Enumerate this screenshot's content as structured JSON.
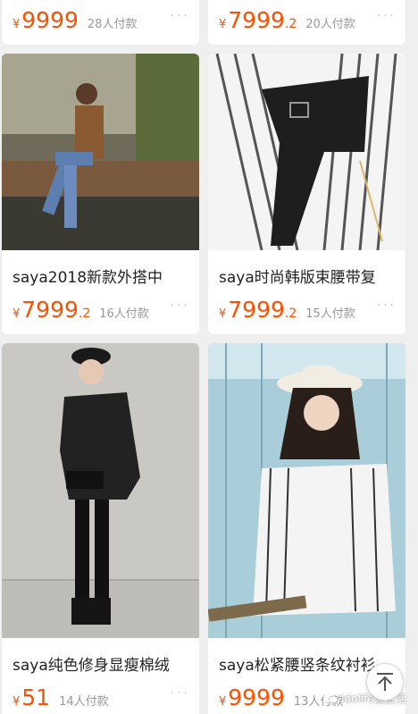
{
  "products": [
    {
      "title": "",
      "price_main": "9999",
      "price_dec": "",
      "buyers": "28人付款"
    },
    {
      "title": "",
      "price_main": "7999",
      "price_dec": ".2",
      "buyers": "20人付款"
    },
    {
      "title": "saya2018新款外搭中",
      "price_main": "7999",
      "price_dec": ".2",
      "buyers": "16人付款"
    },
    {
      "title": "saya时尚韩版束腰带复",
      "price_main": "7999",
      "price_dec": ".2",
      "buyers": "15人付款"
    },
    {
      "title": "saya纯色修身显瘦棉绒",
      "price_main": "51",
      "price_dec": "",
      "buyers": "14人付款"
    },
    {
      "title": "saya松紧腰竖条纹衬衫",
      "price_main": "9999",
      "price_dec": "",
      "buyers": "13人付款"
    }
  ],
  "currency_symbol": "¥",
  "more_icon": "···",
  "watermark": "Idolife爱生活",
  "colors": {
    "price": "#ff5000",
    "background": "#efefef"
  }
}
